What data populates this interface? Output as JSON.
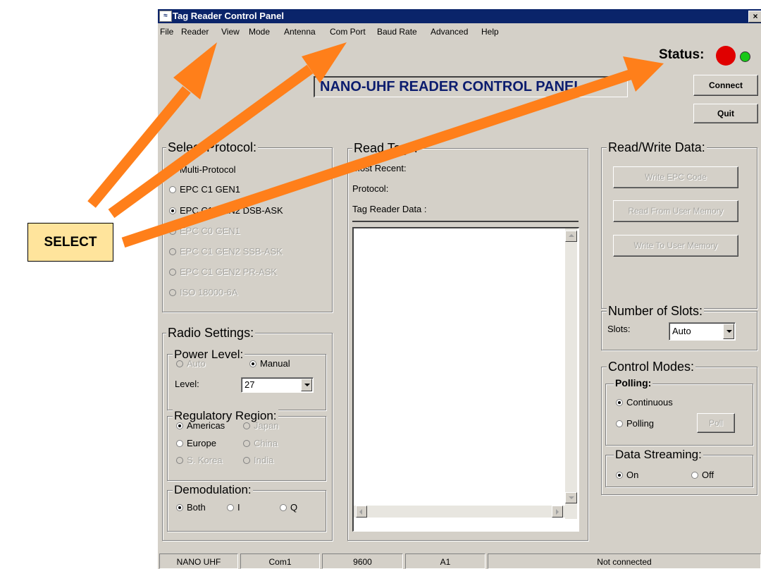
{
  "window": {
    "title": "Tag Reader Control Panel",
    "close_label": "×"
  },
  "menu": [
    "File",
    "Reader",
    "View",
    "Mode",
    "Antenna",
    "Com Port",
    "Baud Rate",
    "Advanced",
    "Help"
  ],
  "status": {
    "label": "Status:",
    "led_left_color": "#e00000",
    "led_right_color": "#18c818"
  },
  "banner": "NANO-UHF READER CONTROL PANEL",
  "buttons": {
    "connect": "Connect",
    "quit": "Quit"
  },
  "protocol": {
    "title": "Select Protocol:",
    "options": [
      "Multi-Protocol",
      "EPC C1 GEN1",
      "EPC C1 GEN2 DSB-ASK",
      "EPC C0 GEN1",
      "EPC C1 GEN2 SSB-ASK",
      "EPC C1 GEN2 PR-ASK",
      "ISO 18000-6A"
    ],
    "selected": "EPC C1 GEN2 DSB-ASK"
  },
  "read_tags": {
    "title": "Read Tags:",
    "most_recent_label": "Most Recent:",
    "protocol_label": "Protocol:",
    "data_label": "Tag Reader Data :"
  },
  "read_write": {
    "title": "Read/Write Data:",
    "write_epc": "Write EPC Code",
    "read_user": "Read From User Memory",
    "write_user": "Write To User Memory"
  },
  "slots": {
    "title": "Number of Slots:",
    "label": "Slots:",
    "value": "Auto"
  },
  "radio": {
    "title": "Radio Settings:",
    "power": {
      "title": "Power Level:",
      "auto": "Auto",
      "manual": "Manual",
      "level_label": "Level:",
      "level_value": "27"
    },
    "region": {
      "title": "Regulatory Region:",
      "americas": "Americas",
      "japan": "Japan",
      "europe": "Europe",
      "china": "China",
      "skorea": "S. Korea",
      "india": "India"
    },
    "demod": {
      "title": "Demodulation:",
      "both": "Both",
      "i": "I",
      "q": "Q"
    }
  },
  "control": {
    "title": "Control Modes:",
    "polling": {
      "title": "Polling:",
      "continuous": "Continuous",
      "polling": "Polling",
      "poll_button": "Poll"
    },
    "streaming": {
      "title": "Data Streaming:",
      "on": "On",
      "off": "Off"
    }
  },
  "statusbar": [
    "NANO UHF",
    "Com1",
    "9600",
    "A1",
    "Not connected"
  ],
  "annotation": {
    "label": "SELECT",
    "arrow_color": "#ff7f1a"
  }
}
